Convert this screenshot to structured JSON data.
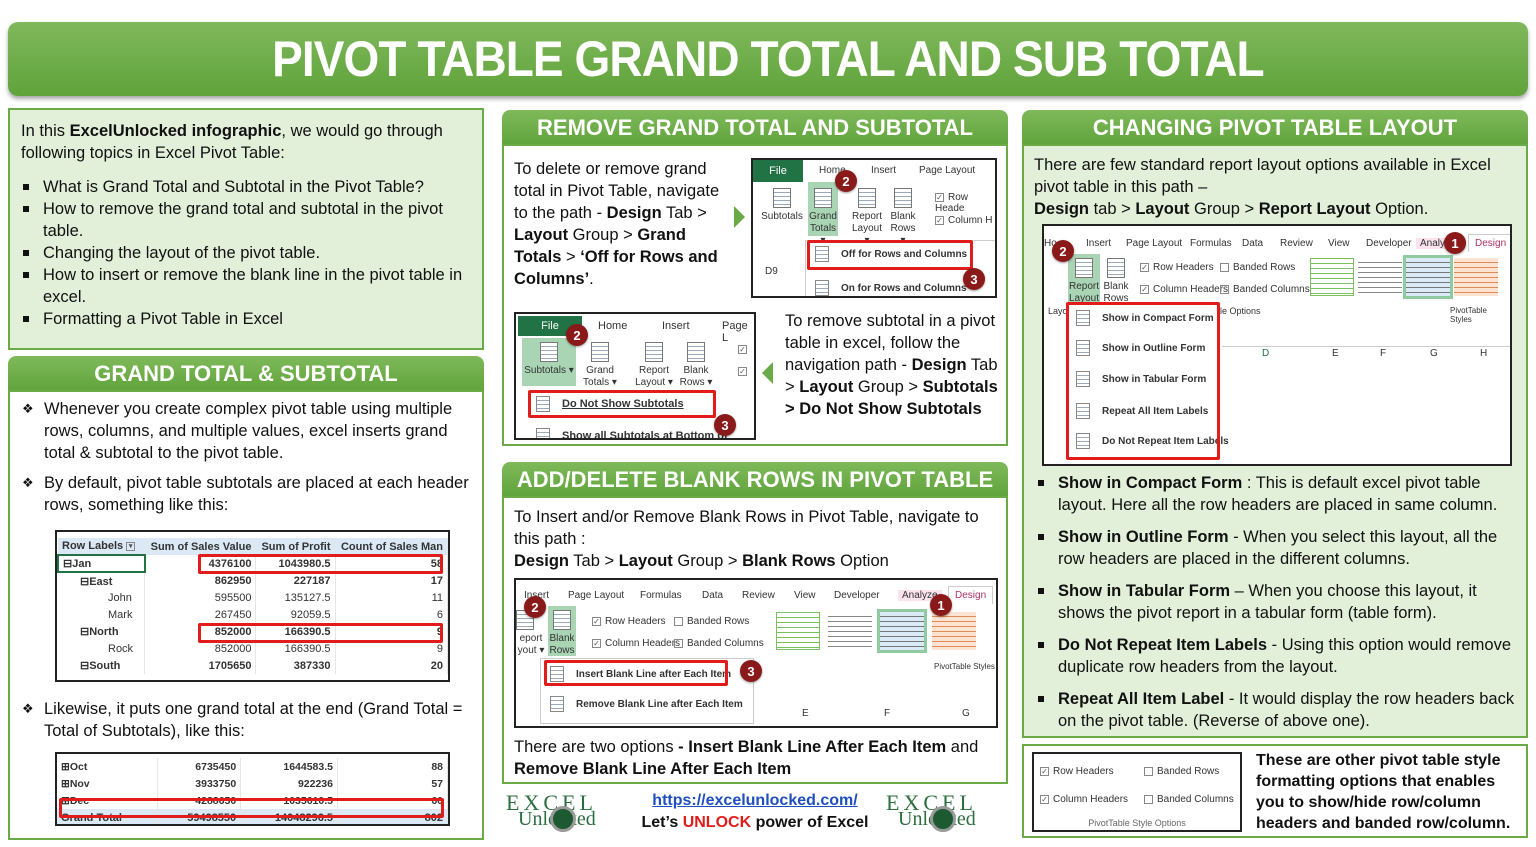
{
  "title": "PIVOT TABLE GRAND TOTAL AND SUB TOTAL",
  "intro": {
    "text_pre": "In this ",
    "text_bold": "ExcelUnlocked infographic",
    "text_post": ", we would go through following topics in Excel Pivot Table:",
    "topics": [
      "What is Grand Total and Subtotal in the Pivot Table?",
      "How to remove the grand total and subtotal in the pivot table.",
      "Changing the layout of the pivot table.",
      "How to insert or remove the blank line in the pivot table in excel.",
      "Formatting a Pivot Table in Excel"
    ]
  },
  "grand_subtotal": {
    "heading": "GRAND TOTAL & SUBTOTAL",
    "point1": "Whenever you create complex pivot table using multiple rows, columns, and multiple values, excel inserts grand total & subtotal to the pivot table.",
    "point2": "By default, pivot table subtotals are placed at each header rows, something like this:",
    "point3": "Likewise, it puts one grand total at the end (Grand Total = Total of Subtotals), like this:",
    "table1": {
      "headers": [
        "Row Labels",
        "Sum of Sales Value",
        "Sum of Profit",
        "Count of Sales Man"
      ],
      "rows": [
        {
          "label": "Jan",
          "indent": 0,
          "bold": true,
          "toggle": "⊟",
          "values": [
            "4376100",
            "1043980.5",
            "58"
          ]
        },
        {
          "label": "East",
          "indent": 1,
          "bold": true,
          "toggle": "⊟",
          "values": [
            "862950",
            "227187",
            "17"
          ]
        },
        {
          "label": "John",
          "indent": 2,
          "bold": false,
          "toggle": "",
          "values": [
            "595500",
            "135127.5",
            "11"
          ]
        },
        {
          "label": "Mark",
          "indent": 2,
          "bold": false,
          "toggle": "",
          "values": [
            "267450",
            "92059.5",
            "6"
          ]
        },
        {
          "label": "North",
          "indent": 1,
          "bold": true,
          "toggle": "⊟",
          "values": [
            "852000",
            "166390.5",
            "9"
          ]
        },
        {
          "label": "Rock",
          "indent": 2,
          "bold": false,
          "toggle": "",
          "values": [
            "852000",
            "166390.5",
            "9"
          ]
        },
        {
          "label": "South",
          "indent": 1,
          "bold": true,
          "toggle": "⊟",
          "values": [
            "1705650",
            "387330",
            "20"
          ]
        }
      ]
    },
    "table2": {
      "rows": [
        {
          "label": "Oct",
          "toggle": "⊞",
          "values": [
            "6735450",
            "1644583.5",
            "88"
          ]
        },
        {
          "label": "Nov",
          "toggle": "⊞",
          "values": [
            "3933750",
            "922236",
            "57"
          ]
        },
        {
          "label": "Dec",
          "toggle": "⊞",
          "values": [
            "4288650",
            "1035610.5",
            "60"
          ]
        }
      ],
      "grand_total": {
        "label": "Grand Total",
        "values": [
          "59498550",
          "14048296.5",
          "802"
        ]
      }
    }
  },
  "remove": {
    "heading": "REMOVE GRAND TOTAL AND SUBTOTAL",
    "grand_text": {
      "t1": "To delete or remove grand total in Pivot Table, navigate to the path - ",
      "b1": "Design",
      "t2": " Tab > ",
      "b2": "Layout",
      "t3": " Group > ",
      "b3": "Grand Totals",
      "t4": " > ",
      "b4": "‘Off for Rows and Columns’",
      "t5": "."
    },
    "sub_text": {
      "t1": "To remove subtotal in a pivot table in excel, follow the navigation path - ",
      "b1": "Design",
      "t2": " Tab > ",
      "b2": "Layout",
      "t3": " Group > ",
      "b3": "Subtotals > Do Not Show Subtotals"
    },
    "shot1": {
      "tabs": [
        "File",
        "Home",
        "Insert",
        "Page Layout"
      ],
      "buttons": [
        "Subtotals",
        "Grand Totals ▾",
        "Report Layout ▾",
        "Blank Rows ▾"
      ],
      "checks": [
        "Row Heade",
        "Column H"
      ],
      "cell": "D9",
      "menu": [
        "Off for Rows and Columns",
        "On for Rows and Columns"
      ],
      "badges": [
        "2",
        "3"
      ]
    },
    "shot2": {
      "tabs": [
        "File",
        "Home",
        "Insert",
        "Page L"
      ],
      "buttons": [
        "Subtotals ▾",
        "Grand Totals ▾",
        "Report Layout ▾",
        "Blank Rows ▾"
      ],
      "menu": [
        "Do Not Show Subtotals",
        "Show all Subtotals at Bottom of"
      ],
      "badges": [
        "2",
        "3"
      ]
    }
  },
  "blank": {
    "heading": "ADD/DELETE BLANK ROWS IN PIVOT TABLE",
    "intro": "To Insert and/or Remove Blank Rows in Pivot Table, navigate to this path :",
    "path": {
      "b1": "Design",
      "t1": " Tab > ",
      "b2": "Layout",
      "t2": " Group > ",
      "b3": "Blank Rows",
      "t3": " Option"
    },
    "shot": {
      "tabs": [
        "Insert",
        "Page Layout",
        "Formulas",
        "Data",
        "Review",
        "View",
        "Developer",
        "Analyze",
        "Design"
      ],
      "buttons": [
        "eport yout ▾",
        "Blank Rows ▾"
      ],
      "checks": [
        {
          "label": "Row Headers",
          "checked": true
        },
        {
          "label": "Banded Rows",
          "checked": false
        },
        {
          "label": "Column Headers",
          "checked": true
        },
        {
          "label": "Banded Columns",
          "checked": false
        }
      ],
      "styles_label": "PivotTable Styles",
      "menu": [
        "Insert Blank Line after Each Item",
        "Remove Blank Line after Each Item"
      ],
      "columns": [
        "E",
        "F",
        "G"
      ],
      "badges": [
        "1",
        "2",
        "3"
      ]
    },
    "footer": {
      "t1": "There are two options ",
      "b1": "- Insert Blank Line After Each Item",
      "t2": " and ",
      "b2": "Remove Blank Line After Each Item"
    }
  },
  "layout": {
    "heading": "CHANGING PIVOT TABLE LAYOUT",
    "intro": "There are few standard report layout options available in Excel pivot table in this path –",
    "path": {
      "b1": "Design",
      "t1": " tab > ",
      "b2": "Layout",
      "t2": " Group > ",
      "b3": "Report Layout",
      "t3": " Option."
    },
    "shot": {
      "tabs": [
        "Ho",
        "Insert",
        "Page Layout",
        "Formulas",
        "Data",
        "Review",
        "View",
        "Developer",
        "Analyz",
        "Design"
      ],
      "buttons": [
        "Report Layout ▾",
        "Blank Rows ▾"
      ],
      "checks": [
        {
          "label": "Row Headers",
          "checked": true
        },
        {
          "label": "Banded Rows",
          "checked": false
        },
        {
          "label": "Column Headers",
          "checked": true
        },
        {
          "label": "Banded Columns",
          "checked": false
        }
      ],
      "group_labels": [
        "Layo",
        "le Options",
        "PivotTable Styles"
      ],
      "menu": [
        "Show in Compact Form",
        "Show in Outline Form",
        "Show in Tabular Form",
        "Repeat All Item Labels",
        "Do Not Repeat Item Labels"
      ],
      "columns": [
        "D",
        "E",
        "F",
        "G",
        "H"
      ],
      "badges": [
        "1",
        "2"
      ]
    },
    "items": [
      {
        "bold": "Show in Compact Form",
        "text": " : This is default excel pivot table layout. Here all the row headers are placed in same column."
      },
      {
        "bold": "Show in Outline Form",
        "text": " - When you select this layout, all the row headers are placed in the different columns."
      },
      {
        "bold": "Show in Tabular Form",
        "text": " – When you choose this layout, it shows the pivot report in a tabular form (table form)."
      },
      {
        "bold": "Do Not Repeat Item Labels",
        "text": " - Using this option would remove duplicate row headers from the layout."
      },
      {
        "bold": "Repeat All Item Label",
        "text": " - It would display the row headers back on the pivot table. (Reverse of above one)."
      }
    ]
  },
  "style_options": {
    "checks": [
      {
        "label": "Row Headers",
        "checked": true
      },
      {
        "label": "Banded Rows",
        "checked": false
      },
      {
        "label": "Column Headers",
        "checked": true
      },
      {
        "label": "Banded Columns",
        "checked": false
      }
    ],
    "caption": "PivotTable Style Options",
    "description": "These are other pivot table style formatting options that enables you to show/hide row/column headers and banded row/column."
  },
  "footer": {
    "url": "https://excelunlocked.com/",
    "tag_pre": "Let’s ",
    "tag_red": "UNLOCK",
    "tag_post": " power of Excel",
    "logo_line1": "EXCEL",
    "logo_line2": "Unlocked"
  },
  "colors": {
    "accent_green": "#6aab47",
    "panel_bg": "#e2efd9",
    "highlight_red": "#e21b1b",
    "badge_maroon": "#8a1a1a",
    "excel_green": "#217346"
  }
}
